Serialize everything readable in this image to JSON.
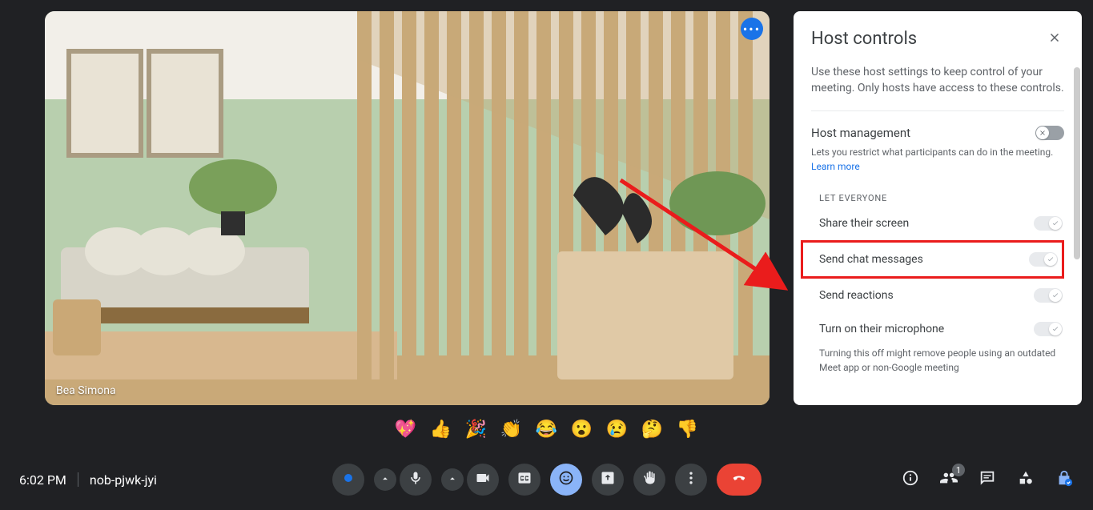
{
  "participant": {
    "name": "Bea Simona"
  },
  "reactions": {
    "heart": "💖",
    "thumbsup": "👍",
    "party": "🎉",
    "clap": "👏",
    "joy": "😂",
    "surprised": "😮",
    "sad": "😢",
    "thinking": "🤔",
    "thumbsdown": "👎"
  },
  "bottom": {
    "time": "6:02 PM",
    "meeting_code": "nob-pjwk-jyi",
    "participants_badge": "1"
  },
  "panel": {
    "title": "Host controls",
    "description": "Use these host settings to keep control of your meeting. Only hosts have access to these controls.",
    "host_management": {
      "title": "Host management",
      "sub": "Lets you restrict what participants can do in the meeting. ",
      "learn_more": "Learn more"
    },
    "subhead": "LET EVERYONE",
    "settings": {
      "share_screen": "Share their screen",
      "send_chat": "Send chat messages",
      "send_reactions": "Send reactions",
      "turn_on_mic": "Turn on their microphone"
    },
    "mic_note": "Turning this off might remove people using an outdated Meet app or non-Google meeting"
  }
}
